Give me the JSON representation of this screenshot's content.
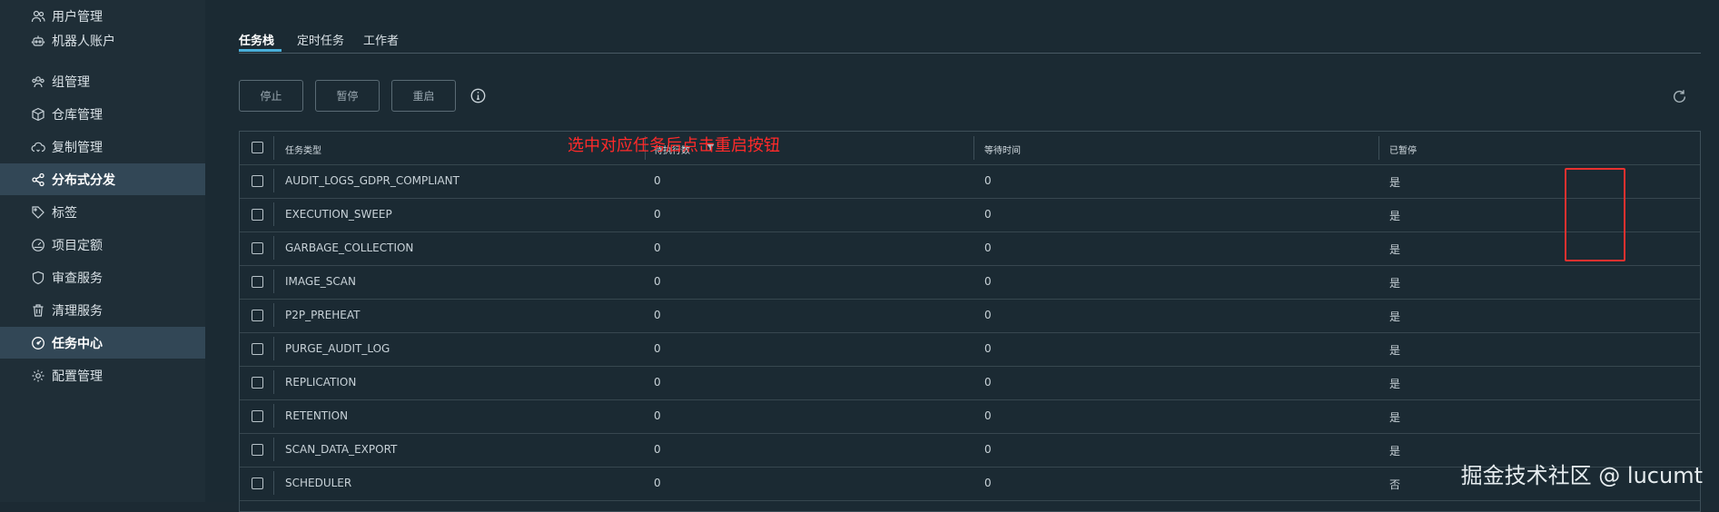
{
  "sidebar": {
    "items": [
      {
        "label": "用户管理",
        "icon": "users-icon",
        "active": false
      },
      {
        "label": "机器人账户",
        "icon": "robot-icon",
        "active": false
      },
      {
        "label": "组管理",
        "icon": "group-icon",
        "active": false
      },
      {
        "label": "仓库管理",
        "icon": "box-icon",
        "active": false
      },
      {
        "label": "复制管理",
        "icon": "cloud-sync-icon",
        "active": false
      },
      {
        "label": "分布式分发",
        "icon": "share-icon",
        "active": true
      },
      {
        "label": "标签",
        "icon": "tag-icon",
        "active": false
      },
      {
        "label": "项目定额",
        "icon": "gauge-icon",
        "active": false
      },
      {
        "label": "审查服务",
        "icon": "shield-icon",
        "active": false
      },
      {
        "label": "清理服务",
        "icon": "trash-icon",
        "active": false
      },
      {
        "label": "任务中心",
        "icon": "dashboard-icon",
        "active": true
      },
      {
        "label": "配置管理",
        "icon": "gear-icon",
        "active": false
      }
    ]
  },
  "tabs": [
    {
      "label": "任务栈",
      "active": true
    },
    {
      "label": "定时任务",
      "active": false
    },
    {
      "label": "工作者",
      "active": false
    }
  ],
  "toolbar": {
    "stop_label": "停止",
    "pause_label": "暂停",
    "restart_label": "重启"
  },
  "table": {
    "headers": [
      "任务类型",
      "待执行数",
      "等待时间",
      "已暂停"
    ],
    "rows": [
      {
        "type": "AUDIT_LOGS_GDPR_COMPLIANT",
        "pending": "0",
        "wait": "0",
        "paused": "是"
      },
      {
        "type": "EXECUTION_SWEEP",
        "pending": "0",
        "wait": "0",
        "paused": "是"
      },
      {
        "type": "GARBAGE_COLLECTION",
        "pending": "0",
        "wait": "0",
        "paused": "是"
      },
      {
        "type": "IMAGE_SCAN",
        "pending": "0",
        "wait": "0",
        "paused": "是"
      },
      {
        "type": "P2P_PREHEAT",
        "pending": "0",
        "wait": "0",
        "paused": "是"
      },
      {
        "type": "PURGE_AUDIT_LOG",
        "pending": "0",
        "wait": "0",
        "paused": "是"
      },
      {
        "type": "REPLICATION",
        "pending": "0",
        "wait": "0",
        "paused": "是"
      },
      {
        "type": "RETENTION",
        "pending": "0",
        "wait": "0",
        "paused": "是"
      },
      {
        "type": "SCAN_DATA_EXPORT",
        "pending": "0",
        "wait": "0",
        "paused": "是"
      },
      {
        "type": "SCHEDULER",
        "pending": "0",
        "wait": "0",
        "paused": "否"
      }
    ]
  },
  "annotation": {
    "text": "选中对应任务后点击重启按钮",
    "color": "#ff2a2a"
  },
  "watermark": "掘金技术社区 @ lucumt",
  "colors": {
    "accent": "#49afd9",
    "sidebar_active": "#324756",
    "background": "#1b2a33"
  }
}
